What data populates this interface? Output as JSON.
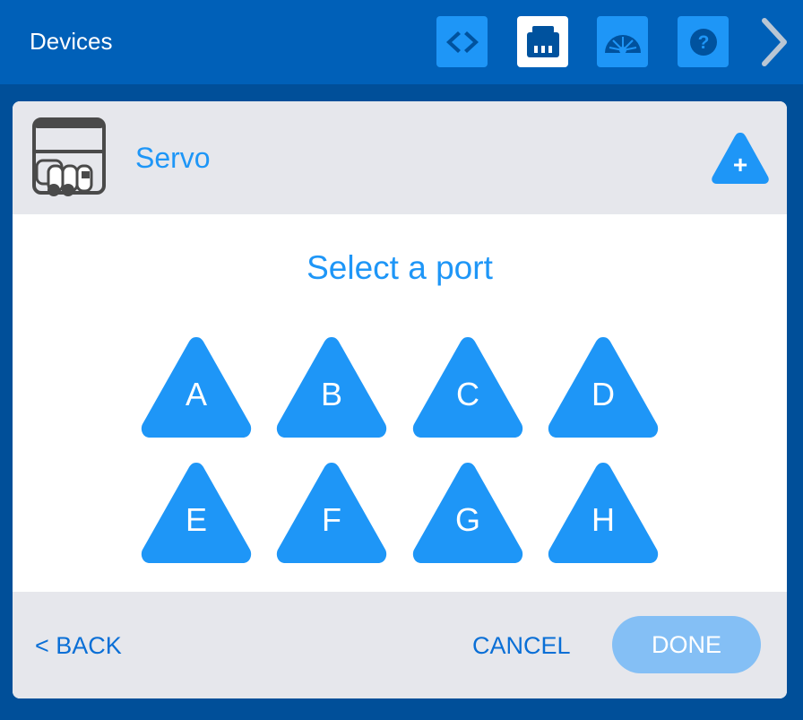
{
  "header": {
    "title": "Devices",
    "tools": [
      {
        "icon": "code-brackets-icon"
      },
      {
        "icon": "devices-port-icon",
        "active": true
      },
      {
        "icon": "dashboard-gauge-icon"
      },
      {
        "icon": "help-icon"
      }
    ],
    "next_icon": "chevron-right-icon"
  },
  "device": {
    "icon": "servo-device-icon",
    "name": "Servo",
    "add_label": "+"
  },
  "prompt": "Select a port",
  "ports": [
    "A",
    "B",
    "C",
    "D",
    "E",
    "F",
    "G",
    "H"
  ],
  "footer": {
    "back": "< BACK",
    "cancel": "CANCEL",
    "done": "DONE"
  },
  "colors": {
    "accent": "#1e96f7",
    "header_bg": "#0060b8",
    "page_bg": "#004f99",
    "panel_header_bg": "#e6e7ec",
    "done_disabled": "#84bff5",
    "link": "#0a6fd6"
  }
}
